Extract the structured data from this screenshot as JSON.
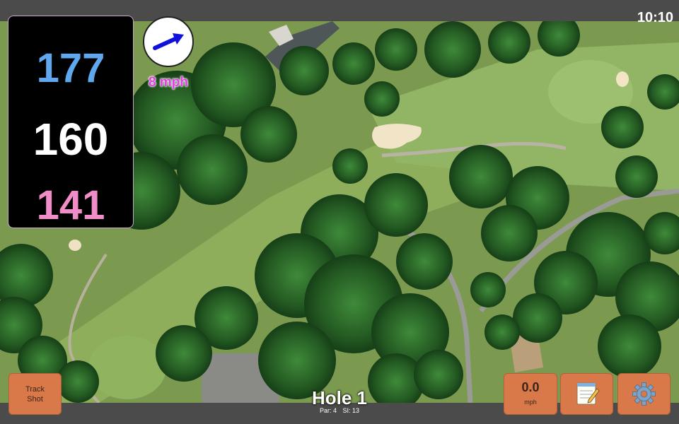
{
  "status": {
    "time": "10:10"
  },
  "distances": {
    "back": "177",
    "middle": "160",
    "front": "141"
  },
  "wind": {
    "speed": "8 mph",
    "arrow_icon": "arrow-right-icon",
    "arrow_color": "#1111dd"
  },
  "hole": {
    "title": "Hole 1",
    "par": "Par: 4",
    "si": "SI: 13"
  },
  "buttons": {
    "track_shot": "Track Shot",
    "speed_value": "0.0",
    "speed_unit": "mph",
    "notes_icon": "notepad-icon",
    "settings_icon": "gear-icon"
  },
  "colors": {
    "back": "#5fa8f0",
    "middle": "#ffffff",
    "front": "#f08cc8",
    "button": "#d9794a",
    "wind_text": "#e040e0"
  }
}
